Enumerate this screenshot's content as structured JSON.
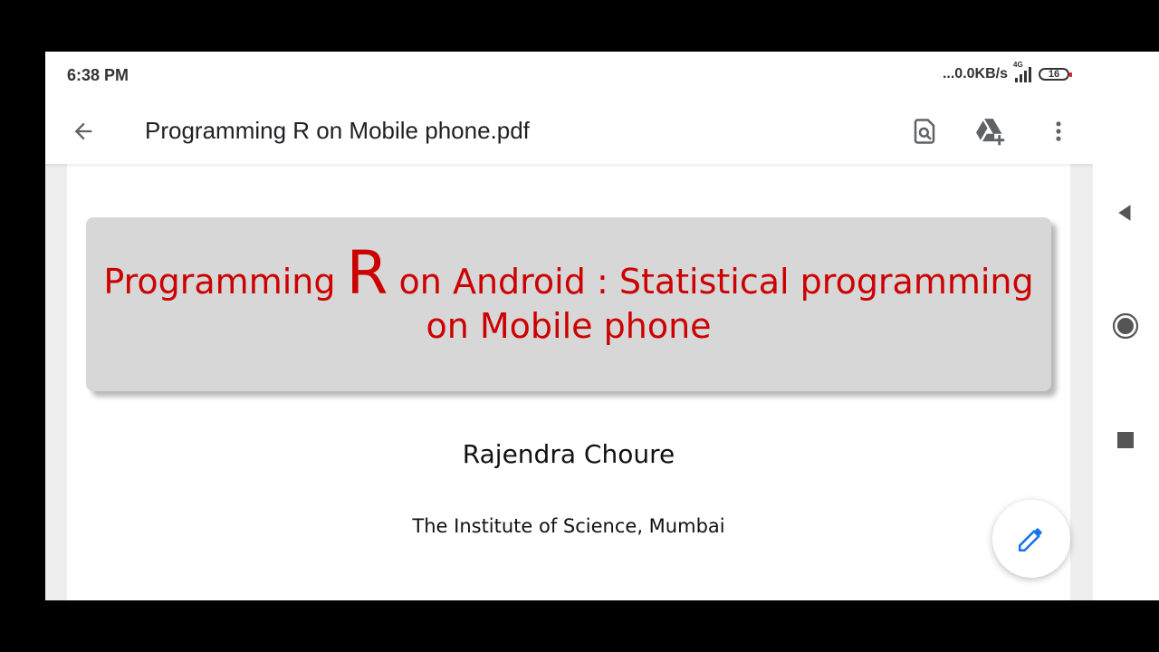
{
  "status_bar": {
    "time": "6:38 PM",
    "network_speed": "...0.0KB/s",
    "network_type": "4G",
    "battery_level": "16"
  },
  "app_bar": {
    "back_icon": "arrow-left-icon",
    "title": "Programming R on Mobile phone.pdf",
    "actions": [
      {
        "icon": "find-in-page-icon"
      },
      {
        "icon": "drive-add-icon"
      },
      {
        "icon": "more-vert-icon"
      }
    ]
  },
  "document": {
    "title_part1": "Programming",
    "title_big_letter": "R",
    "title_part2": "on Android : Statistical programming",
    "title_line2": "on Mobile phone",
    "author": "Rajendra Choure",
    "institute": "The Institute of Science, Mumbai"
  },
  "fab": {
    "icon": "edit-pencil-icon"
  },
  "nav_bar": {
    "buttons": [
      {
        "icon": "back-triangle-icon"
      },
      {
        "icon": "home-circle-icon"
      },
      {
        "icon": "recents-square-icon"
      }
    ]
  },
  "colors": {
    "title_red": "#cc0000",
    "title_box": "#d7d7d7",
    "fab_icon": "#1a73e8",
    "icon_gray": "#5f6368"
  }
}
